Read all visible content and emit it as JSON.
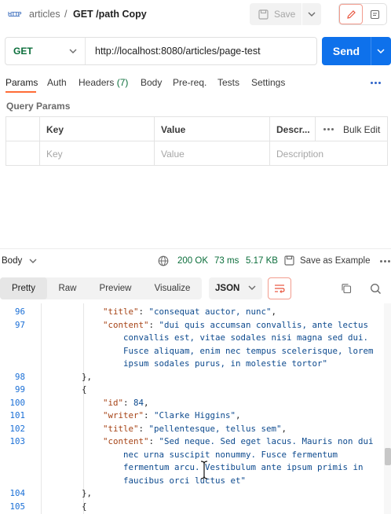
{
  "header": {
    "collection": "articles",
    "separator": "/",
    "request_name": "GET /path Copy",
    "save_label": "Save"
  },
  "request": {
    "method": "GET",
    "url": "http://localhost:8080/articles/page-test",
    "send_label": "Send"
  },
  "tabs": {
    "params": "Params",
    "auth": "Auth",
    "headers": "Headers",
    "headers_count": "(7)",
    "body": "Body",
    "prereq": "Pre-req.",
    "tests": "Tests",
    "settings": "Settings"
  },
  "query_params": {
    "title": "Query Params",
    "columns": {
      "key": "Key",
      "value": "Value",
      "description": "Descr...",
      "bulk_edit": "Bulk Edit"
    },
    "placeholders": {
      "key": "Key",
      "value": "Value",
      "description": "Description"
    }
  },
  "response": {
    "body_label": "Body",
    "status": "200 OK",
    "time": "73 ms",
    "size": "5.17 KB",
    "save_example": "Save as Example",
    "formats": [
      "Pretty",
      "Raw",
      "Preview",
      "Visualize"
    ],
    "language": "JSON"
  },
  "code_lines": [
    {
      "no": "96",
      "text": "\"title\": \"consequat auctor, nunc\","
    },
    {
      "no": "97",
      "text": "\"content\": \"dui quis accumsan convallis, ante lectus"
    },
    {
      "no": "",
      "text": "convallis est, vitae sodales nisi magna sed dui."
    },
    {
      "no": "",
      "text": "Fusce aliquam, enim nec tempus scelerisque, lorem"
    },
    {
      "no": "",
      "text": "ipsum sodales purus, in molestie tortor\""
    },
    {
      "no": "98",
      "text": "},"
    },
    {
      "no": "99",
      "text": "{"
    },
    {
      "no": "100",
      "text": "\"id\": 84,"
    },
    {
      "no": "101",
      "text": "\"writer\": \"Clarke Higgins\","
    },
    {
      "no": "102",
      "text": "\"title\": \"pellentesque, tellus sem\","
    },
    {
      "no": "103",
      "text": "\"content\": \"Sed neque. Sed eget lacus. Mauris non dui"
    },
    {
      "no": "",
      "text": "nec urna suscipit nonummy. Fusce fermentum"
    },
    {
      "no": "",
      "text": "fermentum arcu. Vestibulum ante ipsum primis in"
    },
    {
      "no": "",
      "text": "faucibus orci luctus et\""
    },
    {
      "no": "104",
      "text": "},"
    },
    {
      "no": "105",
      "text": "{"
    }
  ],
  "colors": {
    "accent": "#ff6c37",
    "send": "#0e71eb",
    "method_get": "#0b6e3b",
    "status_ok": "#0b6e3b",
    "json_key": "#a64417",
    "json_string": "#0d4a8e",
    "line_number": "#1a6fd6"
  },
  "icons": [
    "http-file-icon",
    "save-icon",
    "chevron-down-icon",
    "pencil-icon",
    "document-icon",
    "more-icon",
    "globe-icon",
    "save-example-icon",
    "copy-icon",
    "search-icon",
    "wrap-lines-icon",
    "text-cursor-icon"
  ]
}
